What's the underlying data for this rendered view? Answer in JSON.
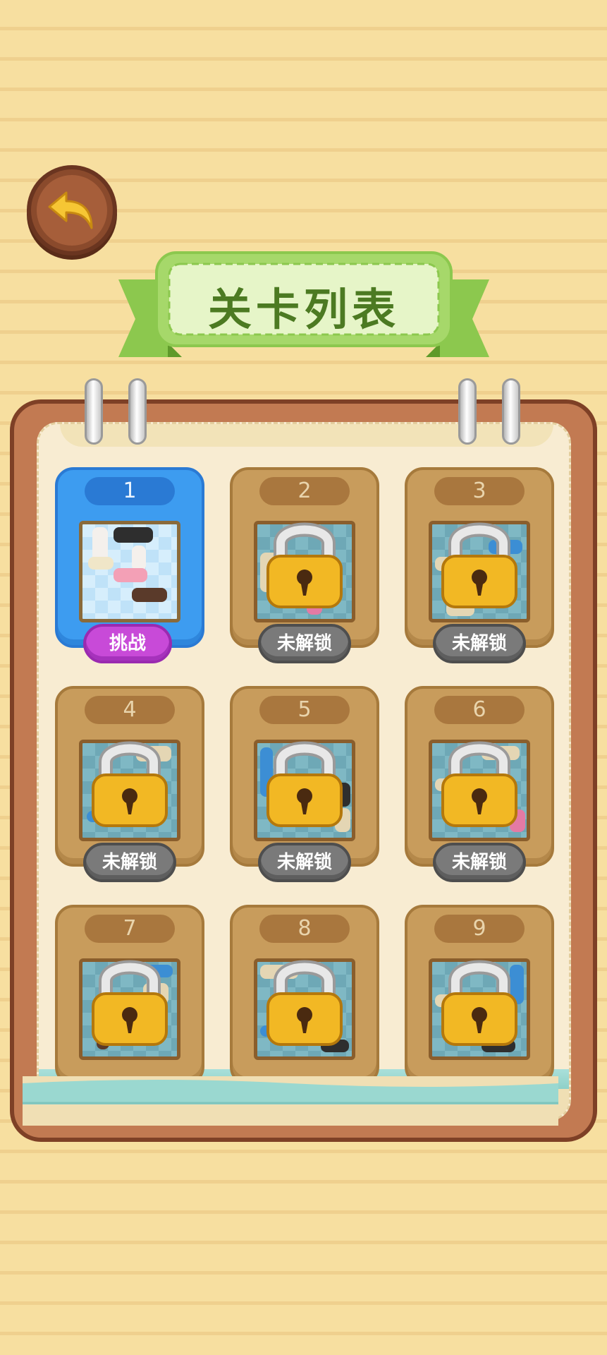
{
  "title": "关卡列表",
  "back_icon": "back-arrow-icon",
  "levels": [
    {
      "number": "1",
      "status": "挑战",
      "locked": false
    },
    {
      "number": "2",
      "status": "未解锁",
      "locked": true
    },
    {
      "number": "3",
      "status": "未解锁",
      "locked": true
    },
    {
      "number": "4",
      "status": "未解锁",
      "locked": true
    },
    {
      "number": "5",
      "status": "未解锁",
      "locked": true
    },
    {
      "number": "6",
      "status": "未解锁",
      "locked": true
    },
    {
      "number": "7",
      "status": "",
      "locked": true
    },
    {
      "number": "8",
      "status": "",
      "locked": true
    },
    {
      "number": "9",
      "status": "",
      "locked": true
    }
  ],
  "colors": {
    "background": "#f7dfa0",
    "banner_green": "#a6d86a",
    "title_green": "#4c7a22",
    "notebook_brown": "#c27a52",
    "card_tan": "#c89c5c",
    "active_blue": "#3d9cf0",
    "challenge_purple": "#c84ad8",
    "locked_gray": "#7a7a7a",
    "lock_gold": "#f2b824"
  }
}
